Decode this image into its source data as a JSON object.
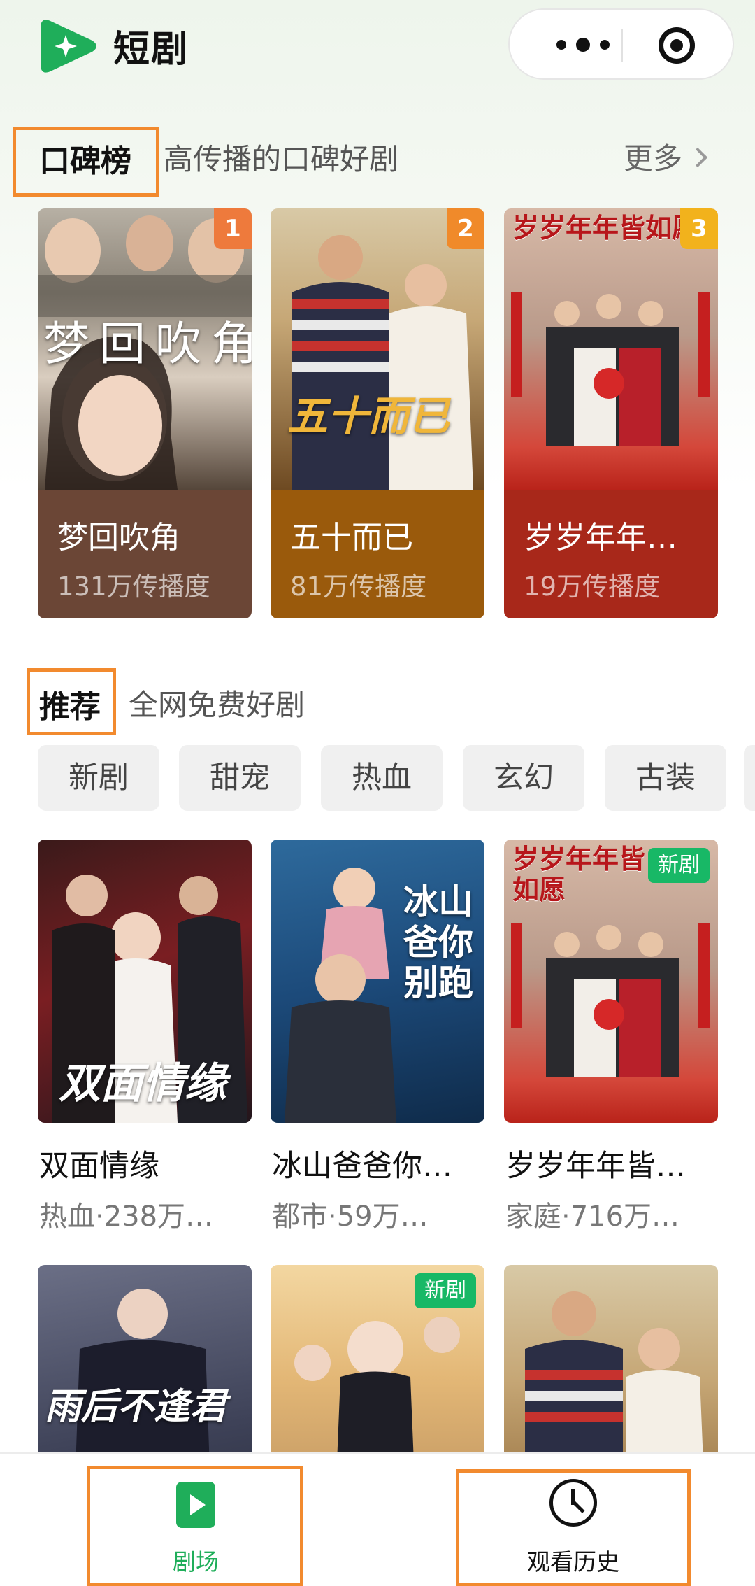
{
  "header": {
    "app_title": "短剧",
    "logo_icon": "play-star-logo",
    "more_icon": "more-dots-icon",
    "close_icon": "target-close-icon"
  },
  "ranking": {
    "title": "口碑榜",
    "subtitle": "高传播的口碑好剧",
    "more_label": "更多",
    "items": [
      {
        "rank": "1",
        "name": "梦回吹角",
        "heat": "131万传播度",
        "poster_title": "梦回吹角",
        "badge_color": "#ee7a3c",
        "foot_color": "#6b4636"
      },
      {
        "rank": "2",
        "name": "五十而已",
        "heat": "81万传播度",
        "poster_title": "五十而已",
        "badge_color": "#f08a2a",
        "foot_color": "#9a5a0c"
      },
      {
        "rank": "3",
        "name": "岁岁年年…",
        "heat": "19万传播度",
        "poster_title": "岁岁年年皆如愿",
        "badge_color": "#f2b21c",
        "foot_color": "#a8281a"
      }
    ]
  },
  "recommend": {
    "title": "推荐",
    "subtitle": "全网免费好剧",
    "chips": [
      "新剧",
      "甜宠",
      "热血",
      "玄幻",
      "古装"
    ],
    "items": [
      {
        "name": "双面情缘",
        "meta": "热血·238万…",
        "poster_title": "双面情缘",
        "tag": ""
      },
      {
        "name": "冰山爸爸你…",
        "meta": "都市·59万…",
        "poster_title": "冰山爸你别跑",
        "tag": ""
      },
      {
        "name": "岁岁年年皆…",
        "meta": "家庭·716万…",
        "poster_title": "岁岁年年皆如愿",
        "tag": "新剧"
      },
      {
        "name": "",
        "meta": "",
        "poster_title": "雨后不逢君",
        "tag": ""
      },
      {
        "name": "",
        "meta": "",
        "poster_title": "",
        "tag": "新剧"
      },
      {
        "name": "",
        "meta": "",
        "poster_title": "",
        "tag": ""
      }
    ]
  },
  "tabbar": {
    "tabs": [
      {
        "label": "剧场",
        "icon": "play-icon",
        "active": true
      },
      {
        "label": "观看历史",
        "icon": "clock-icon",
        "active": false
      }
    ]
  },
  "colors": {
    "accent": "#1fae5a",
    "highlight": "#f28a2e",
    "tag_green": "#18b866"
  }
}
